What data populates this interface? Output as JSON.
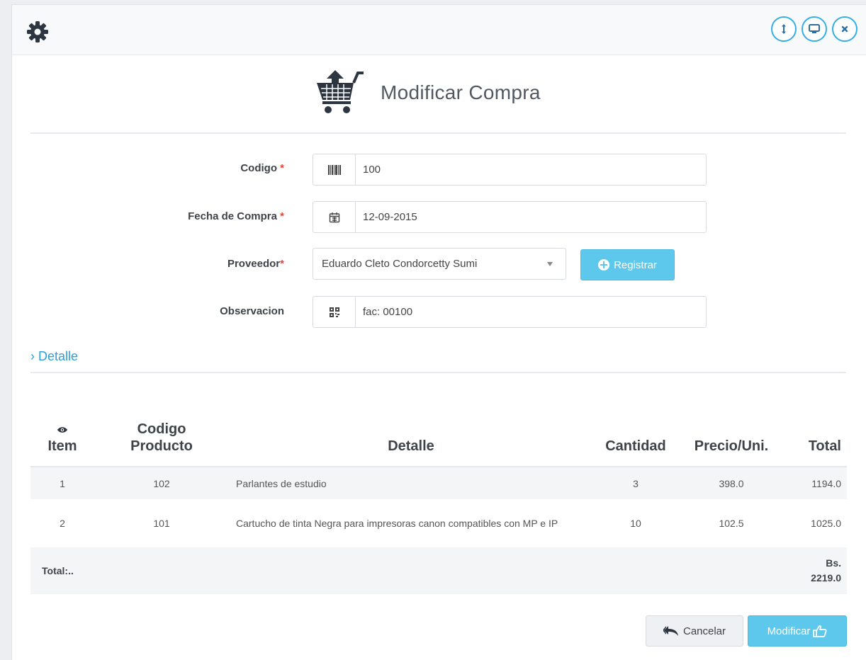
{
  "header": {
    "icons": [
      "gear-icon",
      "resize-icon",
      "desktop-icon",
      "close-icon"
    ]
  },
  "page": {
    "title": "Modificar Compra"
  },
  "form": {
    "codigo": {
      "label": "Codigo",
      "required_mark": "*",
      "value": "100",
      "icon": "barcode-icon"
    },
    "fecha": {
      "label": "Fecha de Compra",
      "required_mark": "*",
      "value": "12-09-2015",
      "icon": "calendar-icon"
    },
    "proveedor": {
      "label": "Proveedor",
      "required_mark": "*",
      "value": "Eduardo Cleto Condorcetty Sumi"
    },
    "observacion": {
      "label": "Observacion",
      "value": "fac: 00100",
      "icon": "qrcode-icon"
    },
    "registrar_label": "Registrar"
  },
  "detalle": {
    "link_label": "› Detalle",
    "columns": {
      "item": "Item",
      "codigo_1": "Codigo",
      "codigo_2": "Producto",
      "detalle": "Detalle",
      "cantidad": "Cantidad",
      "precio": "Precio/Uni.",
      "total": "Total"
    },
    "rows": [
      {
        "item": "1",
        "codigo": "102",
        "detalle": "Parlantes de estudio",
        "cantidad": "3",
        "precio": "398.0",
        "total": "1194.0"
      },
      {
        "item": "2",
        "codigo": "101",
        "detalle": "Cartucho de tinta Negra para impresoras canon compatibles con MP e IP",
        "cantidad": "10",
        "precio": "102.5",
        "total": "1025.0"
      }
    ],
    "total_label": "Total:..",
    "total_currency": "Bs.",
    "total_value": "2219.0"
  },
  "actions": {
    "cancel_label": "Cancelar",
    "modify_label": "Modificar"
  },
  "colors": {
    "accent": "#5ec8ec",
    "link": "#2a9fdc",
    "required": "#e2473b"
  }
}
